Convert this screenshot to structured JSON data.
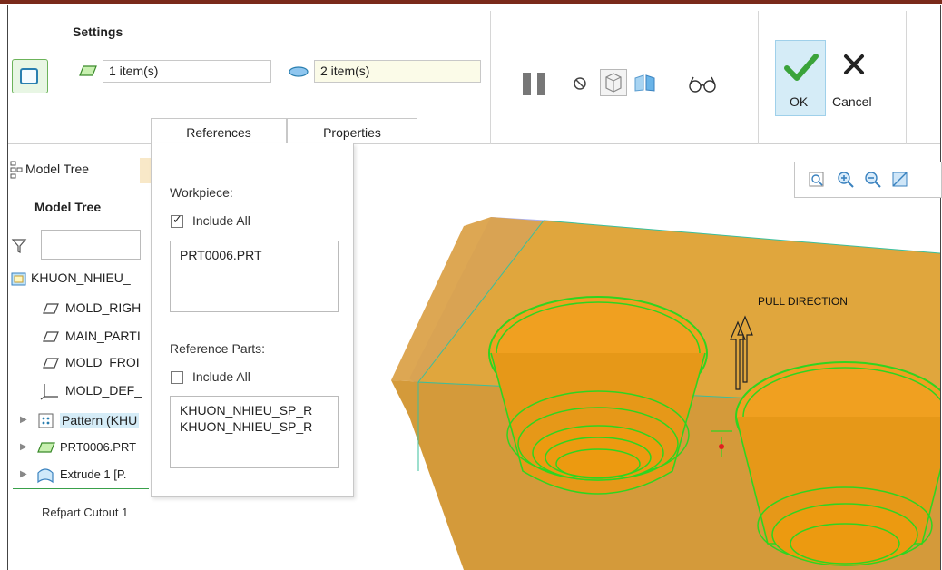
{
  "ribbon": {
    "settings_title": "Settings",
    "field1_value": "1 item(s)",
    "field2_value": "2 item(s)",
    "ok_label": "OK",
    "cancel_label": "Cancel",
    "tabs": [
      {
        "label": "References"
      },
      {
        "label": "Properties"
      }
    ]
  },
  "model_tree": {
    "tab_label": "Model Tree",
    "title": "Model Tree",
    "items": [
      {
        "label": "KHUON_NHIEU_",
        "icon": "assembly-icon"
      },
      {
        "label": "MOLD_RIGH",
        "icon": "datum-plane-icon"
      },
      {
        "label": "MAIN_PARTI",
        "icon": "datum-plane-icon"
      },
      {
        "label": "MOLD_FROI",
        "icon": "datum-plane-icon"
      },
      {
        "label": "MOLD_DEF_",
        "icon": "csys-icon"
      },
      {
        "label": "Pattern (KHU",
        "icon": "pattern-icon"
      },
      {
        "label": "PRT0006.PRT",
        "icon": "part-icon"
      },
      {
        "label": "Extrude 1 [P.",
        "icon": "extrude-icon"
      }
    ],
    "feature_label": "Refpart Cutout 1"
  },
  "references": {
    "workpiece_label": "Workpiece:",
    "workpiece_include_all": "Include All",
    "workpiece_include_checked": true,
    "workpiece_items": [
      "PRT0006.PRT"
    ],
    "refparts_label": "Reference Parts:",
    "refparts_include_all": "Include All",
    "refparts_include_checked": false,
    "refparts_items": [
      "KHUON_NHIEU_SP_R",
      "KHUON_NHIEU_SP_R"
    ]
  },
  "viewport": {
    "annotation": "PULL DIRECTION"
  },
  "colors": {
    "accent_ok": "#3aa33a",
    "ok_bg": "#d5ecf7",
    "model_fill": "#e6a51c",
    "edge_green": "#33cc22",
    "header_rule": "#7a2a1a"
  }
}
